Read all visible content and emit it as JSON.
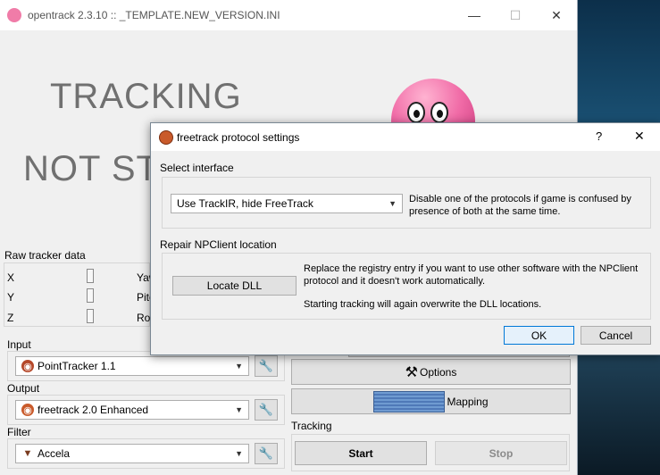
{
  "main_window": {
    "title": "opentrack 2.3.10 :: _TEMPLATE.NEW_VERSION.INI",
    "minimize_glyph": "—",
    "maximize_glyph": "☐",
    "close_glyph": "✕",
    "status_line1": "TRACKING",
    "status_line2": "NOT ST",
    "raw_tracker": {
      "heading": "Raw tracker data",
      "axes_left": [
        "X",
        "Y",
        "Z"
      ],
      "axes_right_partial": [
        "Yaw",
        "Pitc",
        "Rol"
      ]
    },
    "input": {
      "label": "Input",
      "value": "PointTracker 1.1",
      "icon": "pointtracker-icon"
    },
    "output": {
      "label": "Output",
      "value": "freetrack 2.0 Enhanced",
      "icon": "freetrack-icon"
    },
    "filter": {
      "label": "Filter",
      "value": "Accela",
      "icon": "accela-icon"
    },
    "buttons": {
      "options": "Options",
      "mapping": "Mapping",
      "start": "Start",
      "stop": "Stop"
    },
    "tracking_label": "Tracking"
  },
  "dialog": {
    "title": "freetrack protocol settings",
    "help_glyph": "?",
    "close_glyph": "✕",
    "select_interface": {
      "heading": "Select interface",
      "selected": "Use TrackIR, hide FreeTrack",
      "note": "Disable one of the protocols if game is confused by presence of both at the same time."
    },
    "repair": {
      "heading": "Repair NPClient location",
      "button": "Locate DLL",
      "note1": "Replace the registry entry if you want to use other software with the NPClient protocol and it doesn't work automatically.",
      "note2": "Starting tracking will again overwrite the DLL locations."
    },
    "ok": "OK",
    "cancel": "Cancel"
  }
}
